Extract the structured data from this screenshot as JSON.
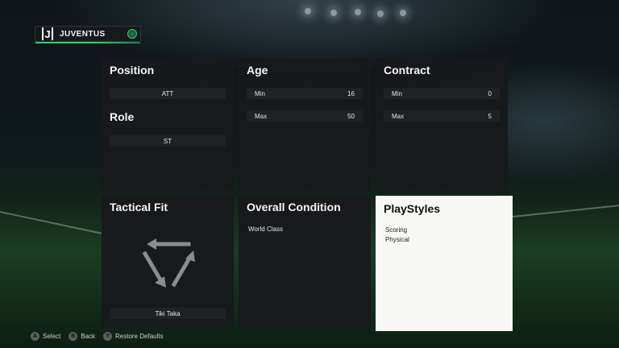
{
  "club": {
    "name": "JUVENTUS",
    "logo_glyph": "J",
    "badge_icon": "house-icon"
  },
  "panels": {
    "position": {
      "title": "Position",
      "value": "ATT",
      "role_title": "Role",
      "role_value": "ST"
    },
    "age": {
      "title": "Age",
      "min_label": "Min",
      "min_value": "16",
      "max_label": "Max",
      "max_value": "50"
    },
    "contract": {
      "title": "Contract",
      "min_label": "Min",
      "min_value": "0",
      "max_label": "Max",
      "max_value": "5"
    },
    "tactical_fit": {
      "title": "Tactical Fit",
      "value": "Tiki Taka",
      "icon": "rotating-arrows-icon"
    },
    "overall_condition": {
      "title": "Overall Condition",
      "value": "World Class"
    },
    "playstyles": {
      "title": "PlayStyles",
      "items": [
        "Scoring",
        "Physical"
      ]
    }
  },
  "footer": {
    "select": {
      "button": "A",
      "label": "Select"
    },
    "back": {
      "button": "B",
      "label": "Back"
    },
    "restore": {
      "button": "Y",
      "label": "Restore Defaults"
    }
  },
  "colors": {
    "accent": "#2ecc71",
    "panel": "#18191b",
    "row": "#202124",
    "highlight_panel": "#f7f7f5"
  }
}
